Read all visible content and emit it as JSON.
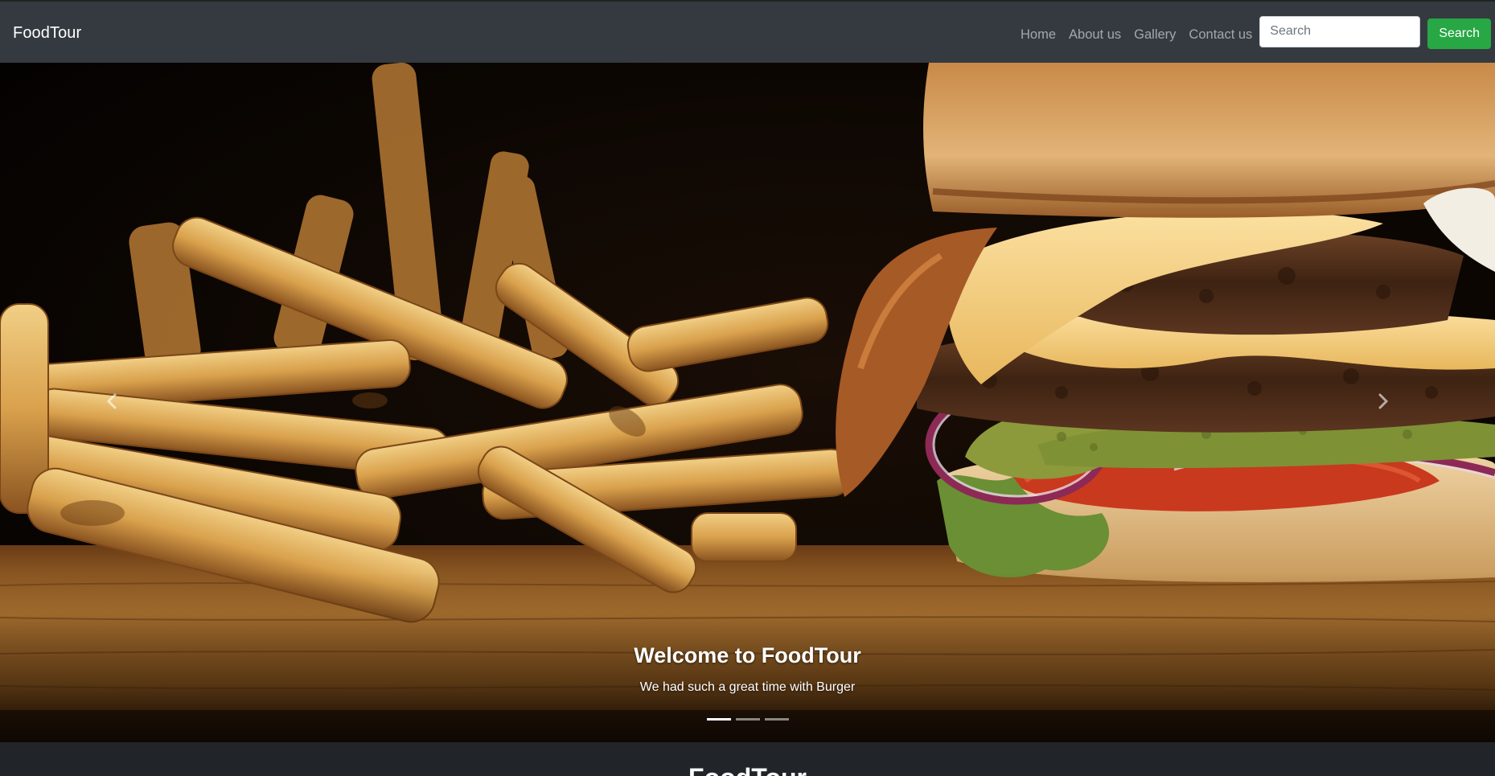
{
  "navbar": {
    "brand": "FoodTour",
    "links": [
      "Home",
      "About us",
      "Gallery",
      "Contact us"
    ],
    "search_placeholder": "Search",
    "search_button": "Search"
  },
  "hero": {
    "title": "Welcome to FoodTour",
    "subtitle": "We had such a great time with Burger",
    "slide_count": 3,
    "active_slide": 1,
    "prev_icon": "chevron-left-icon",
    "next_icon": "chevron-right-icon"
  },
  "section": {
    "title": "FoodTour"
  },
  "colors": {
    "navbar_bg": "#343a40",
    "search_button": "#28a745",
    "page_bg": "#212529"
  }
}
